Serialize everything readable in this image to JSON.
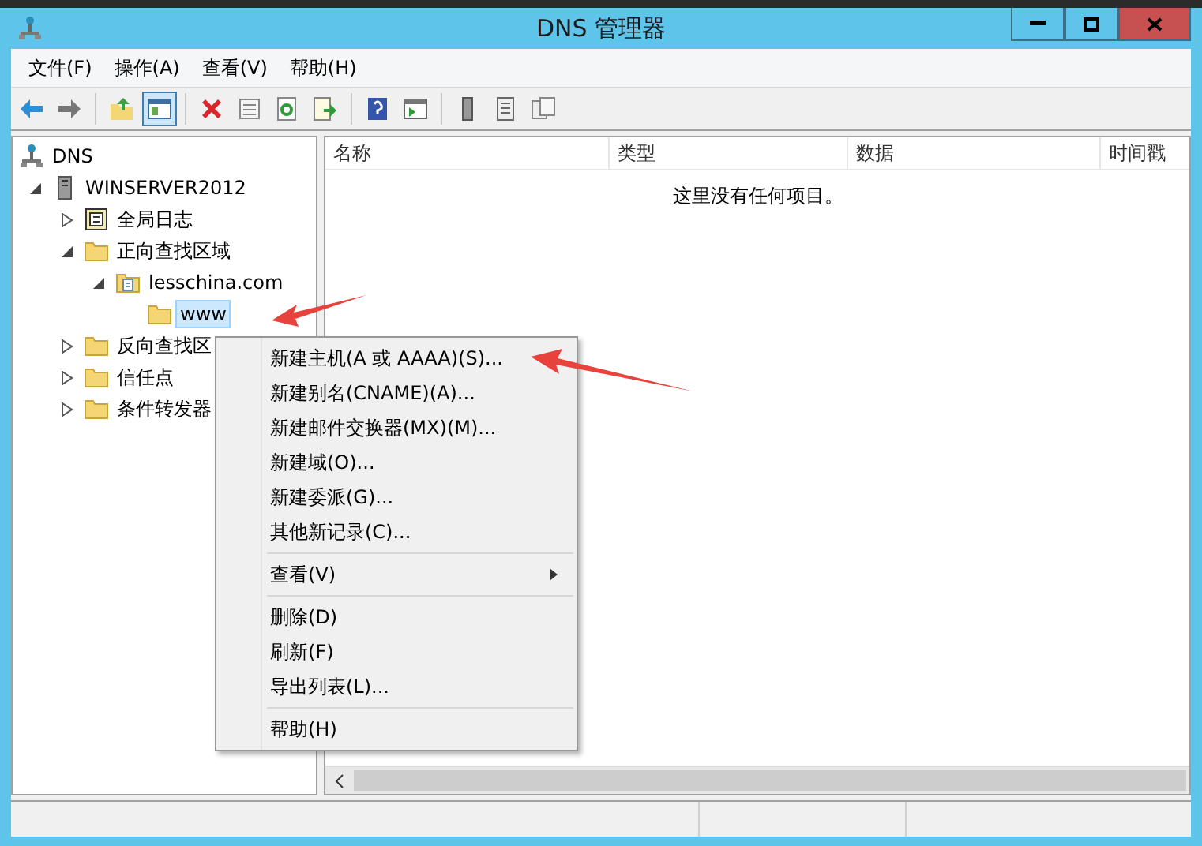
{
  "window": {
    "title": "DNS 管理器"
  },
  "menu_bar": [
    {
      "label": "文件(F)"
    },
    {
      "label": "操作(A)"
    },
    {
      "label": "查看(V)"
    },
    {
      "label": "帮助(H)"
    }
  ],
  "toolbar": [
    {
      "kind": "back",
      "pressed": false
    },
    {
      "kind": "forward",
      "pressed": false
    },
    {
      "kind": "separator"
    },
    {
      "kind": "up",
      "pressed": false
    },
    {
      "kind": "console",
      "pressed": true
    },
    {
      "kind": "separator"
    },
    {
      "kind": "delete",
      "pressed": false
    },
    {
      "kind": "properties",
      "pressed": false
    },
    {
      "kind": "refresh",
      "pressed": false
    },
    {
      "kind": "export",
      "pressed": false
    },
    {
      "kind": "separator"
    },
    {
      "kind": "help",
      "pressed": false
    },
    {
      "kind": "action",
      "pressed": false
    },
    {
      "kind": "separator"
    },
    {
      "kind": "server",
      "pressed": false
    },
    {
      "kind": "list",
      "pressed": false
    },
    {
      "kind": "copy",
      "pressed": false
    }
  ],
  "tree": [
    {
      "label": "DNS",
      "kind": "network",
      "selected": false,
      "children": [
        {
          "label": "WINSERVER2012",
          "kind": "server",
          "selected": false,
          "expanded": true,
          "children": [
            {
              "label": "全局日志",
              "kind": "log",
              "selected": false,
              "expanded": false
            },
            {
              "label": "正向查找区域",
              "kind": "folder",
              "selected": false,
              "expanded": true,
              "children": [
                {
                  "label": "lesschina.com",
                  "kind": "zone",
                  "selected": false,
                  "expanded": true,
                  "children": [
                    {
                      "label": "www",
                      "kind": "folder",
                      "selected": true
                    }
                  ]
                }
              ]
            },
            {
              "label": "反向查找区",
              "kind": "folder",
              "selected": false,
              "expanded": false
            },
            {
              "label": "信任点",
              "kind": "folder",
              "selected": false,
              "expanded": false
            },
            {
              "label": "条件转发器",
              "kind": "folder",
              "selected": false,
              "expanded": false
            }
          ]
        }
      ]
    }
  ],
  "table": {
    "columns": [
      "名称",
      "类型",
      "数据",
      "时间戳"
    ],
    "empty_message": "这里没有任何项目。"
  },
  "context_menu": [
    [
      {
        "label": "新建主机(A 或 AAAA)(S)...",
        "submenu": false
      },
      {
        "label": "新建别名(CNAME)(A)...",
        "submenu": false
      },
      {
        "label": "新建邮件交换器(MX)(M)...",
        "submenu": false
      },
      {
        "label": "新建域(O)...",
        "submenu": false
      },
      {
        "label": "新建委派(G)...",
        "submenu": false
      },
      {
        "label": "其他新记录(C)...",
        "submenu": false
      }
    ],
    [
      {
        "label": "查看(V)",
        "submenu": true
      }
    ],
    [
      {
        "label": "删除(D)",
        "submenu": false
      },
      {
        "label": "刷新(F)",
        "submenu": false
      },
      {
        "label": "导出列表(L)...",
        "submenu": false
      }
    ],
    [
      {
        "label": "帮助(H)",
        "submenu": false
      }
    ]
  ]
}
